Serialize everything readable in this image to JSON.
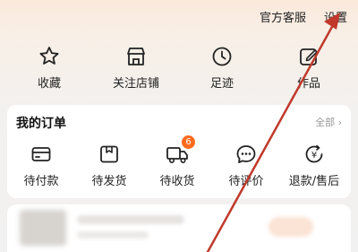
{
  "header": {
    "service_label": "官方客服",
    "settings_label": "设置"
  },
  "quick_actions": [
    {
      "label": "收藏",
      "icon": "star-icon"
    },
    {
      "label": "关注店铺",
      "icon": "store-icon"
    },
    {
      "label": "足迹",
      "icon": "clock-icon"
    },
    {
      "label": "作品",
      "icon": "edit-icon"
    }
  ],
  "orders": {
    "title": "我的订单",
    "view_all": "全部",
    "items": [
      {
        "label": "待付款",
        "icon": "wallet-icon"
      },
      {
        "label": "待发货",
        "icon": "package-icon"
      },
      {
        "label": "待收货",
        "icon": "truck-icon",
        "badge": "6"
      },
      {
        "label": "待评价",
        "icon": "comment-icon"
      },
      {
        "label": "退款/售后",
        "icon": "refund-icon"
      }
    ]
  },
  "colors": {
    "accent": "#ff6a1f",
    "annotation_arrow": "#c0392b"
  }
}
